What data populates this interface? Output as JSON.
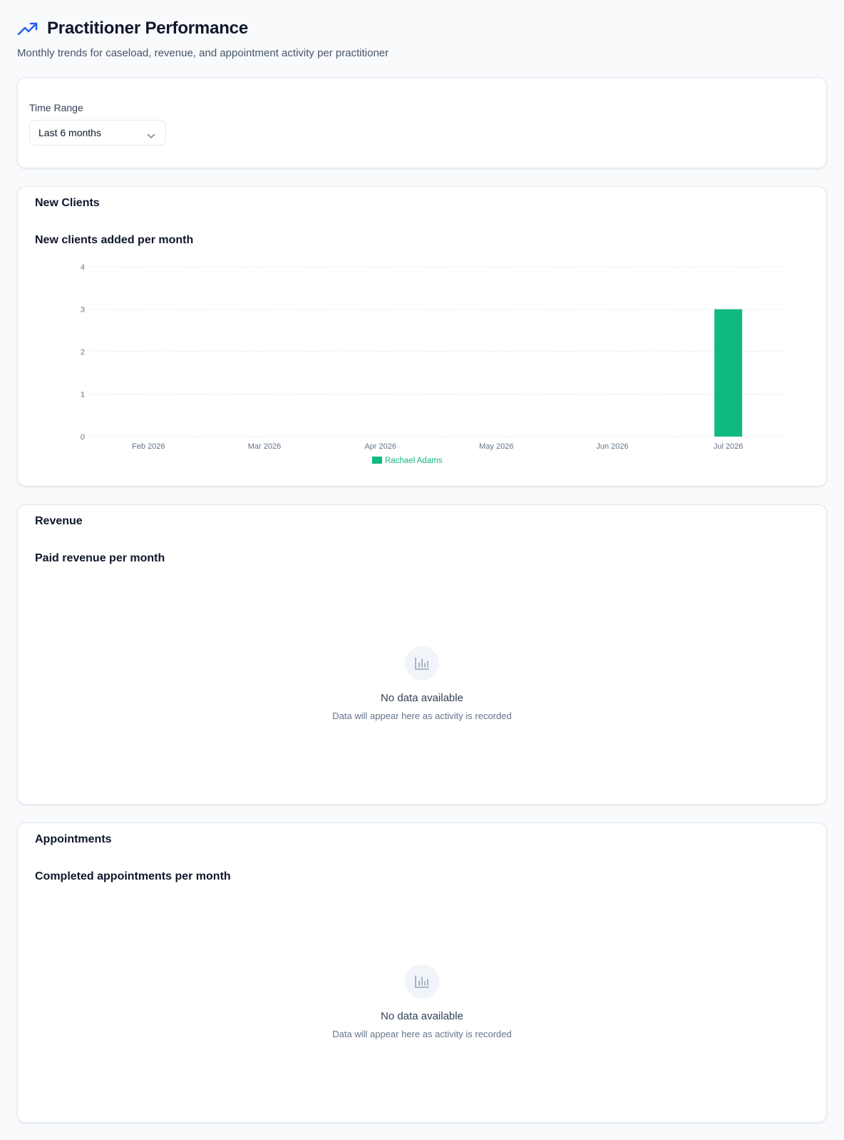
{
  "header": {
    "title": "Practitioner Performance",
    "subtitle": "Monthly trends for caseload, revenue, and appointment activity per practitioner",
    "icon": "trending-up-icon",
    "accent": "#2563eb"
  },
  "filters": {
    "time_range_label": "Time Range",
    "time_range_value": "Last 6 months"
  },
  "new_clients": {
    "title": "New Clients",
    "subtitle": "New clients added per month"
  },
  "revenue": {
    "title": "Revenue",
    "subtitle": "Paid revenue per month",
    "empty_title": "No data available",
    "empty_desc": "Data will appear here as activity is recorded"
  },
  "appointments": {
    "title": "Appointments",
    "subtitle": "Completed appointments per month",
    "empty_title": "No data available",
    "empty_desc": "Data will appear here as activity is recorded"
  },
  "chart_data": {
    "type": "bar",
    "title": "New clients added per month",
    "categories": [
      "Feb 2026",
      "Mar 2026",
      "Apr 2026",
      "May 2026",
      "Jun 2026",
      "Jul 2026"
    ],
    "series": [
      {
        "name": "Rachael Adams",
        "values": [
          0,
          0,
          0,
          0,
          0,
          3
        ],
        "color": "#10b981"
      }
    ],
    "ylim": [
      0,
      4
    ],
    "yticks": [
      0,
      1,
      2,
      3,
      4
    ],
    "grid": true,
    "legend": "bottom-center"
  }
}
